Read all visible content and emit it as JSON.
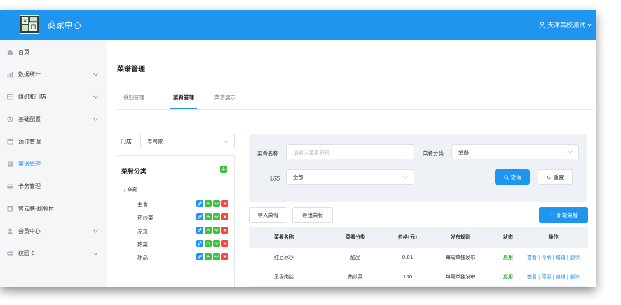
{
  "header": {
    "app_title": "商家中心",
    "user_name": "天津高校测试"
  },
  "sidebar": {
    "items": [
      {
        "label": "首页",
        "icon": "home-icon",
        "expandable": false,
        "active": false
      },
      {
        "label": "数据统计",
        "icon": "bar-chart-icon",
        "expandable": true,
        "active": false
      },
      {
        "label": "组织和门店",
        "icon": "store-icon",
        "expandable": true,
        "active": false
      },
      {
        "label": "基础配置",
        "icon": "settings-icon",
        "expandable": true,
        "active": false
      },
      {
        "label": "预订管理",
        "icon": "calendar-icon",
        "expandable": false,
        "active": false
      },
      {
        "label": "菜谱管理",
        "icon": "menu-book-icon",
        "expandable": false,
        "active": true
      },
      {
        "label": "卡务管理",
        "icon": "card-icon",
        "expandable": false,
        "active": false
      },
      {
        "label": "智云膳-刷脸付",
        "icon": "face-scan-icon",
        "expandable": false,
        "active": false
      },
      {
        "label": "会员中心",
        "icon": "user-icon",
        "expandable": true,
        "active": false
      },
      {
        "label": "校园卡",
        "icon": "id-card-icon",
        "expandable": true,
        "active": false
      }
    ]
  },
  "page": {
    "title": "菜谱管理",
    "tabs": [
      {
        "label": "餐别管理",
        "active": false
      },
      {
        "label": "菜肴管理",
        "active": true
      },
      {
        "label": "菜谱展示",
        "active": false
      }
    ]
  },
  "store": {
    "label": "门店:",
    "value": "寿司家"
  },
  "categories": {
    "title": "菜肴分类",
    "root": "全部",
    "items": [
      "主食",
      "热炒菜",
      "凉菜",
      "热菜",
      "甜品"
    ]
  },
  "filter": {
    "dish_name_label": "菜肴名称",
    "dish_name_placeholder": "请输入菜肴名称",
    "category_label": "菜肴分类",
    "category_value": "全部",
    "status_label": "状态",
    "status_value": "全部",
    "search_button": "查询",
    "reset_button": "重置"
  },
  "actions": {
    "import_button": "导入菜肴",
    "export_button": "导出菜肴",
    "add_button": "新增菜肴"
  },
  "table": {
    "columns": [
      "菜肴名称",
      "菜肴分类",
      "价格(元)",
      "发布规则",
      "状态",
      "操作"
    ],
    "rows": [
      {
        "name": "红豆冰沙",
        "category": "甜品",
        "price": "0.01",
        "rule": "每周单独发布",
        "status": "启用"
      },
      {
        "name": "鱼香肉丝",
        "category": "热炒菜",
        "price": "100",
        "rule": "每周单独发布",
        "status": "启用"
      }
    ],
    "ops": {
      "view": "查看",
      "disable": "停用",
      "edit": "编辑",
      "delete": "删除",
      "sep": "|"
    }
  },
  "colors": {
    "primary": "#1f95ef",
    "success": "#3cb34a",
    "danger": "#f04848",
    "sidebar_bg": "#f4f6f8"
  }
}
